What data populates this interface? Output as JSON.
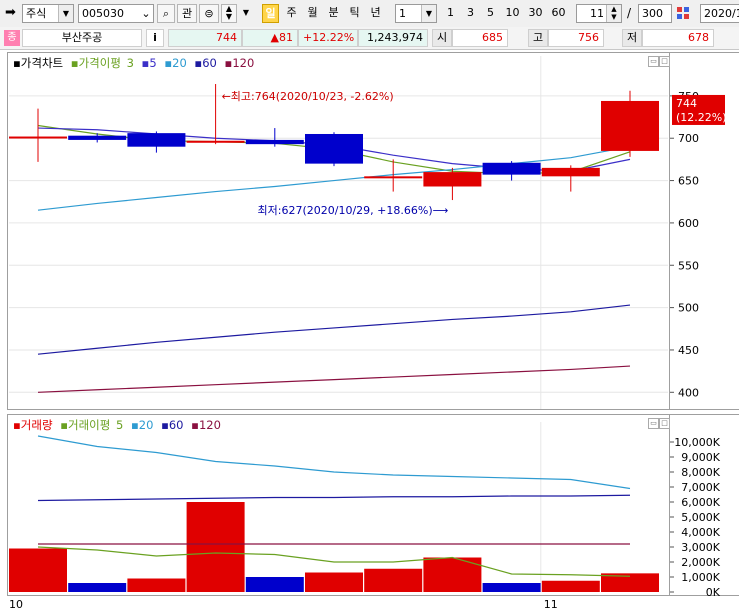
{
  "toolbar": {
    "market_type": "주식",
    "stock_code": "005030",
    "watch_label": "관",
    "period_buttons": [
      "일",
      "주",
      "월",
      "분",
      "틱",
      "년"
    ],
    "period_active": "일",
    "interval_value": "1",
    "interval_quick": [
      "1",
      "3",
      "5",
      "10",
      "30",
      "60"
    ],
    "count_value": "11",
    "separator": "/",
    "total_value": "300",
    "date_value": "2020/1"
  },
  "infobar": {
    "badge": "종",
    "stock_name": "부산주공",
    "info_label": "i",
    "price": "744",
    "change": "▲81",
    "change_rate": "+12.22%",
    "volume": "1,243,974",
    "open_label": "시",
    "open_value": "685",
    "high_label": "고",
    "high_value": "756",
    "low_label": "저",
    "low_value": "678"
  },
  "price_panel": {
    "legend": {
      "price_chart": "가격차트",
      "ma_label": "가격이평",
      "ma_periods": [
        "3",
        "5",
        "20",
        "60",
        "120"
      ]
    },
    "y_ticks": [
      "750",
      "700",
      "650",
      "600",
      "550",
      "500",
      "450",
      "400"
    ],
    "current_price_tag": "744",
    "current_rate_tag": "(12.22%)",
    "high_annotation": "←최고:764(2020/10/23, -2.62%)",
    "low_annotation": "최저:627(2020/10/29, +18.66%)⟶"
  },
  "volume_panel": {
    "legend": {
      "volume": "거래량",
      "ma_label": "거래이평",
      "ma_periods": [
        "5",
        "20",
        "60",
        "120"
      ]
    },
    "y_ticks": [
      "10,000K",
      "9,000K",
      "8,000K",
      "7,000K",
      "6,000K",
      "5,000K",
      "4,000K",
      "3,000K",
      "2,000K",
      "1,000K",
      "0K"
    ]
  },
  "x_axis": {
    "labels": [
      "10",
      "11"
    ]
  },
  "colors": {
    "up": "#e00000",
    "down": "#0000cc",
    "ma3": "#6aa121",
    "ma5": "#3b2fc8",
    "ma20": "#2e9bd1",
    "ma60": "#1d1aa0",
    "ma120": "#8a1040"
  },
  "chart_data": {
    "type": "candlestick",
    "candles": [
      {
        "open": 700,
        "high": 735,
        "low": 672,
        "close": 702
      },
      {
        "open": 703,
        "high": 706,
        "low": 695,
        "close": 698
      },
      {
        "open": 706,
        "high": 708,
        "low": 683,
        "close": 690
      },
      {
        "open": 695,
        "high": 764,
        "low": 693,
        "close": 697
      },
      {
        "open": 698,
        "high": 712,
        "low": 690,
        "close": 693
      },
      {
        "open": 705,
        "high": 707,
        "low": 667,
        "close": 670
      },
      {
        "open": 655,
        "high": 675,
        "low": 637,
        "close": 655
      },
      {
        "open": 643,
        "high": 665,
        "low": 627,
        "close": 660
      },
      {
        "open": 671,
        "high": 673,
        "low": 650,
        "close": 657
      },
      {
        "open": 655,
        "high": 668,
        "low": 637,
        "close": 665
      },
      {
        "open": 685,
        "high": 756,
        "low": 678,
        "close": 744
      }
    ],
    "ma": {
      "3": [
        715,
        705,
        697,
        696,
        694,
        687,
        672,
        661,
        658,
        660,
        684
      ],
      "5": [
        712,
        710,
        705,
        700,
        697,
        692,
        680,
        670,
        664,
        661,
        675
      ],
      "20": [
        615,
        623,
        630,
        637,
        643,
        650,
        657,
        663,
        670,
        677,
        690
      ],
      "60": [
        445,
        452,
        459,
        465,
        471,
        476,
        481,
        486,
        490,
        495,
        503
      ],
      "120": [
        400,
        403,
        406,
        409,
        412,
        415,
        418,
        421,
        424,
        427,
        431
      ]
    },
    "volume_up": [
      true,
      false,
      true,
      true,
      false,
      true,
      true,
      true,
      false,
      true,
      true
    ],
    "volume": [
      2900,
      600,
      900,
      6000,
      1000,
      1300,
      1550,
      2300,
      600,
      750,
      1243
    ],
    "volume_ma": {
      "5": [
        10400,
        9700,
        9300,
        8700,
        8400,
        8000,
        7800,
        7700,
        7600,
        7500,
        6900
      ],
      "20": [
        3000,
        2800,
        2400,
        2600,
        2500,
        2000,
        2000,
        2300,
        1200,
        1150,
        1050
      ],
      "60": [
        6100,
        6150,
        6200,
        6250,
        6300,
        6300,
        6350,
        6350,
        6400,
        6400,
        6450
      ],
      "120": [
        3200,
        3200,
        3200,
        3200,
        3200,
        3200,
        3200,
        3200,
        3200,
        3200,
        3200
      ]
    },
    "y_range": [
      385,
      790
    ],
    "volume_range": [
      0,
      10800
    ],
    "x_labels": [
      "10",
      "11"
    ]
  }
}
